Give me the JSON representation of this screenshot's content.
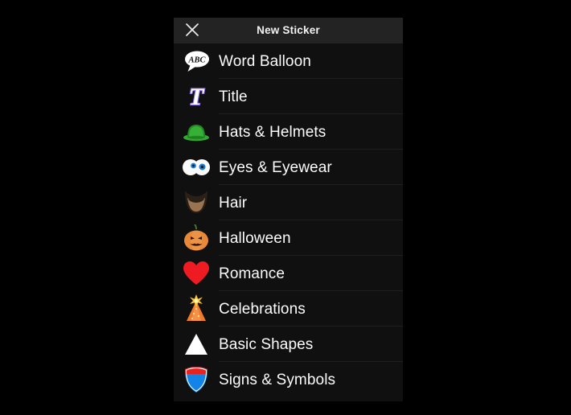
{
  "panel": {
    "header": {
      "close_icon": "close-icon",
      "close_label": "Close",
      "title": "New Sticker"
    },
    "categories": [
      {
        "label": "Word Balloon",
        "icon": "word-balloon-icon"
      },
      {
        "label": "Title",
        "icon": "title-letter-t-icon"
      },
      {
        "label": "Hats & Helmets",
        "icon": "bowler-hat-icon"
      },
      {
        "label": "Eyes & Eyewear",
        "icon": "googly-eyes-icon"
      },
      {
        "label": "Hair",
        "icon": "beard-icon"
      },
      {
        "label": "Halloween",
        "icon": "jack-o-lantern-icon"
      },
      {
        "label": "Romance",
        "icon": "heart-icon"
      },
      {
        "label": "Celebrations",
        "icon": "party-hat-icon"
      },
      {
        "label": "Basic Shapes",
        "icon": "triangle-icon"
      },
      {
        "label": "Signs & Symbols",
        "icon": "highway-shield-icon"
      }
    ]
  },
  "colors": {
    "page_background": "#000000",
    "panel_background": "#101010",
    "header_background": "#232323",
    "divider": "#1f1f1f",
    "text_primary": "#fbfbfb",
    "title_accent": "#b9a9ee",
    "hat_green": "#2ea02e",
    "eye_blue": "#1f7fd6",
    "beard_brown": "#8d6a4a",
    "pumpkin_orange": "#e8893a",
    "heart_red": "#ee1c22",
    "party_orange": "#f07a30",
    "shape_white": "#ffffff",
    "shield_red": "#e8231f",
    "shield_blue": "#1383e8"
  }
}
